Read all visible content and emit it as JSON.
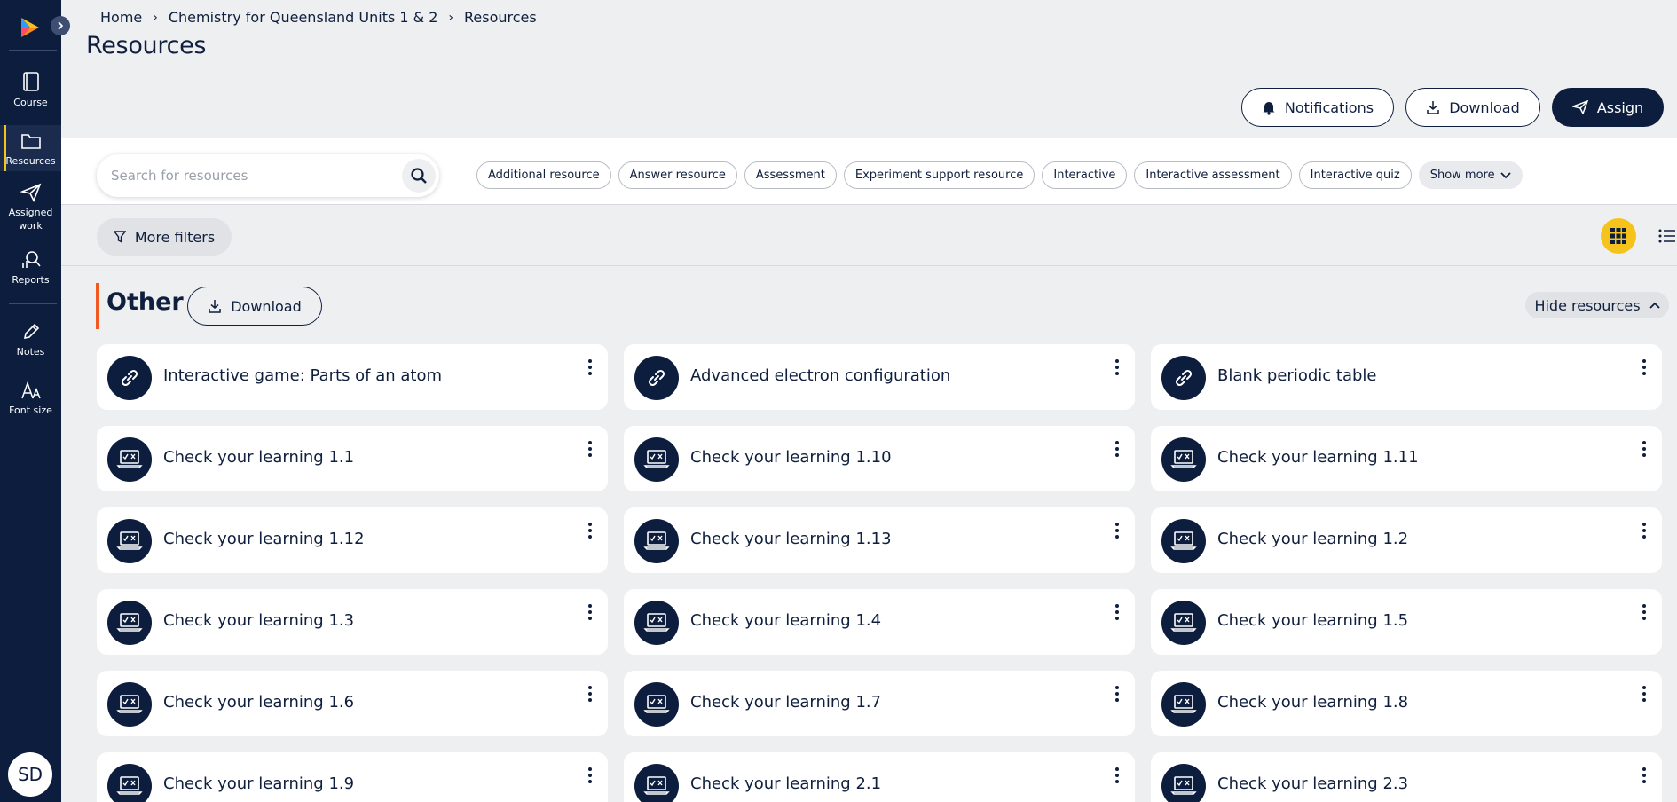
{
  "sidebar": {
    "items": [
      {
        "label": "Course",
        "icon": "book-icon"
      },
      {
        "label": "Resources",
        "icon": "folder-icon"
      },
      {
        "label": "Assigned work",
        "icon": "paper-plane-icon"
      },
      {
        "label": "Reports",
        "icon": "reports-icon"
      },
      {
        "label": "Notes",
        "icon": "pencil-icon"
      },
      {
        "label": "Font size",
        "icon": "font-size-icon"
      }
    ],
    "active": "Resources",
    "avatar": "SD"
  },
  "header": {
    "breadcrumb": [
      "Home",
      "Chemistry for Queensland Units 1 & 2",
      "Resources"
    ],
    "title": "Resources",
    "buttons": {
      "notifications": "Notifications",
      "download": "Download",
      "assign": "Assign"
    }
  },
  "filters": {
    "search_placeholder": "Search for resources",
    "chips": [
      "Additional resource",
      "Answer resource",
      "Assessment",
      "Experiment support resource",
      "Interactive",
      "Interactive assessment",
      "Interactive quiz"
    ],
    "show_more": "Show more",
    "more_filters": "More filters",
    "view_mode": "grid"
  },
  "section": {
    "title": "Other",
    "download": "Download",
    "hide": "Hide resources",
    "accent": "#f05a22"
  },
  "resources": [
    {
      "title": "Interactive game: Parts of an atom",
      "icon": "link-icon"
    },
    {
      "title": "Advanced electron configuration",
      "icon": "link-icon"
    },
    {
      "title": "Blank periodic table",
      "icon": "link-icon"
    },
    {
      "title": "Check your learning 1.1",
      "icon": "laptop-quiz-icon"
    },
    {
      "title": "Check your learning 1.10",
      "icon": "laptop-quiz-icon"
    },
    {
      "title": "Check your learning 1.11",
      "icon": "laptop-quiz-icon"
    },
    {
      "title": "Check your learning 1.12",
      "icon": "laptop-quiz-icon"
    },
    {
      "title": "Check your learning 1.13",
      "icon": "laptop-quiz-icon"
    },
    {
      "title": "Check your learning 1.2",
      "icon": "laptop-quiz-icon"
    },
    {
      "title": "Check your learning 1.3",
      "icon": "laptop-quiz-icon"
    },
    {
      "title": "Check your learning 1.4",
      "icon": "laptop-quiz-icon"
    },
    {
      "title": "Check your learning 1.5",
      "icon": "laptop-quiz-icon"
    },
    {
      "title": "Check your learning 1.6",
      "icon": "laptop-quiz-icon"
    },
    {
      "title": "Check your learning 1.7",
      "icon": "laptop-quiz-icon"
    },
    {
      "title": "Check your learning 1.8",
      "icon": "laptop-quiz-icon"
    },
    {
      "title": "Check your learning 1.9",
      "icon": "laptop-quiz-icon"
    },
    {
      "title": "Check your learning 2.1",
      "icon": "laptop-quiz-icon"
    },
    {
      "title": "Check your learning 2.3",
      "icon": "laptop-quiz-icon"
    }
  ],
  "colors": {
    "navy": "#0c1d3e",
    "accent_yellow": "#f6c21c",
    "background": "#eeeff1"
  }
}
